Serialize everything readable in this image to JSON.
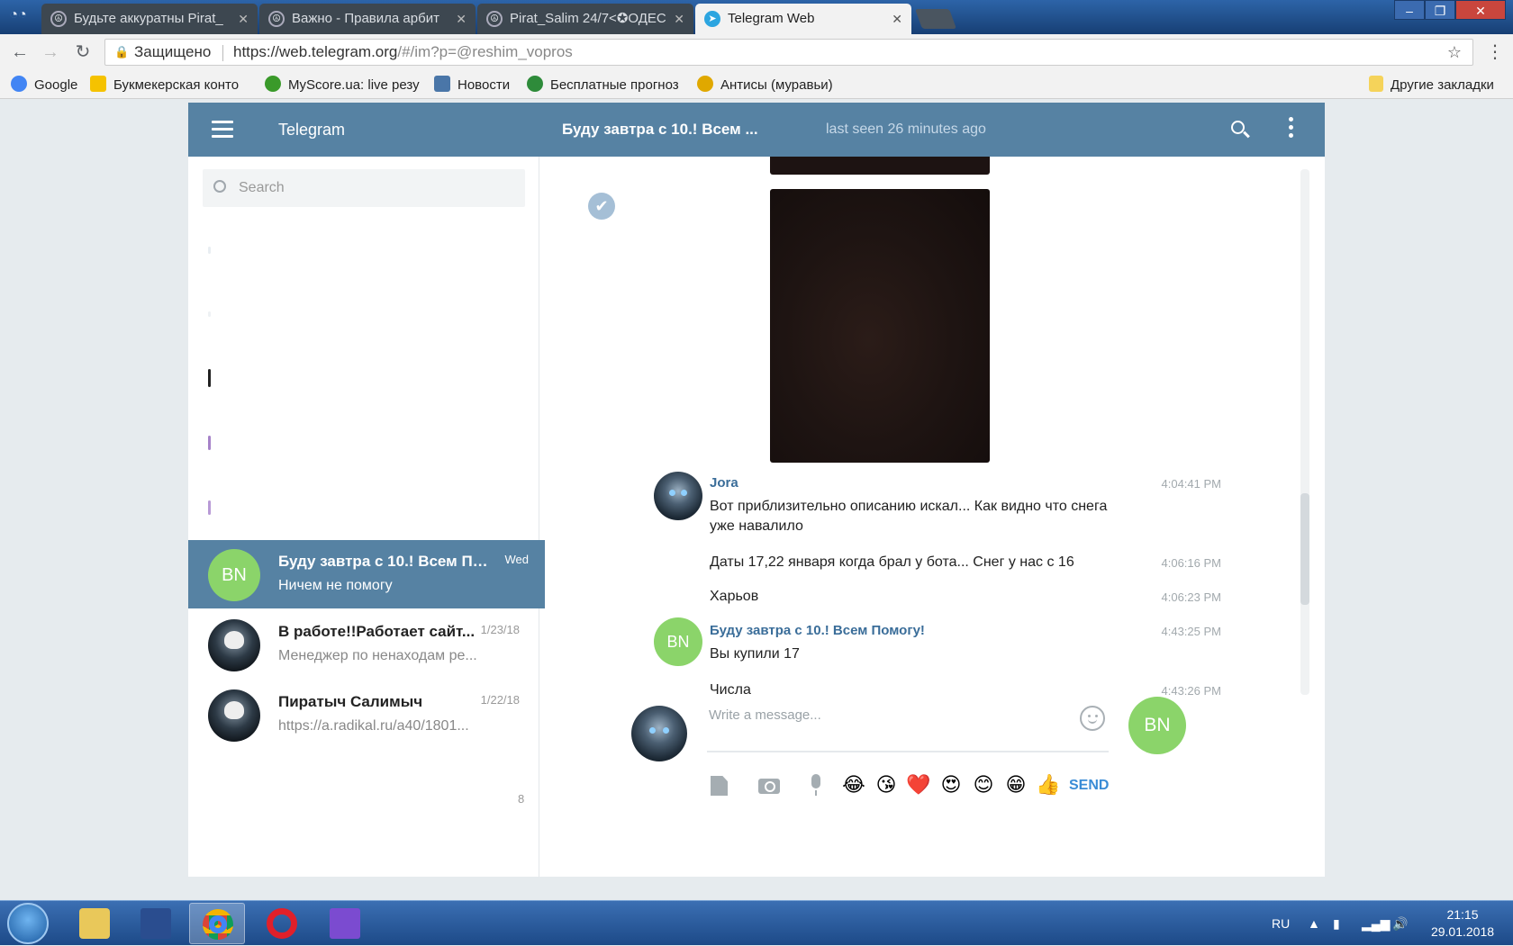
{
  "browser": {
    "tabs": [
      {
        "title": "Будьте аккуратны Pirat_",
        "active": false
      },
      {
        "title": "Важно - Правила арбит",
        "active": false
      },
      {
        "title": "Pirat_Salim 24/7<✪ОДЕС",
        "active": false
      },
      {
        "title": "Telegram Web",
        "active": true
      }
    ],
    "security_label": "Защищено",
    "url_host": "https://web.telegram.org",
    "url_path": "/#/im?p=@reshim_vopros",
    "bookmarks": [
      {
        "label": "Google",
        "color": "#4285f4"
      },
      {
        "label": "Букмекерская конто",
        "color": "#f5c200"
      },
      {
        "label": "MyScore.ua: live резу",
        "color": "#3a9a2a"
      },
      {
        "label": "Новости",
        "color": "#4a76a8"
      },
      {
        "label": "Бесплатные прогноз",
        "color": "#2e8b3a"
      },
      {
        "label": "Антисы (муравьи)",
        "color": "#e0a800"
      }
    ],
    "other_bookmarks": "Другие закладки"
  },
  "telegram": {
    "app_title": "Telegram",
    "peer_name": "Буду завтра с 10.! Всем ...",
    "peer_status": "last seen 26 minutes ago",
    "search_placeholder": "Search",
    "dialogs": [
      {
        "avatar_initials": "BN",
        "name": "Буду завтра с 10.! Всем По...",
        "preview": "Ничем не помогу",
        "date": "Wed",
        "active": true
      },
      {
        "avatar_initials": "",
        "name": "В работе!!Работает сайт...",
        "preview": "Менеджер по ненаходам ре...",
        "date": "1/23/18",
        "active": false
      },
      {
        "avatar_initials": "",
        "name": "Пиратыч Салимыч",
        "preview": "https://a.radikal.ru/a40/1801...",
        "date": "1/22/18",
        "active": false
      }
    ],
    "stray_counter": "8",
    "messages": [
      {
        "sender": "Jora",
        "text": "Вот приблизительно описанию искал... Как видно что снега уже навалило",
        "time": "4:04:41 PM"
      },
      {
        "sender": "",
        "text": "Даты 17,22 января когда брал у бота... Снег у нас с 16",
        "time": "4:06:16 PM"
      },
      {
        "sender": "",
        "text": "Харьов",
        "time": "4:06:23 PM"
      },
      {
        "sender": "Буду завтра с 10.! Всем Помогу!",
        "avatar_initials": "BN",
        "text": "Вы купили 17",
        "time": "4:43:25 PM"
      },
      {
        "sender": "",
        "text": "Числа",
        "time": "4:43:26 PM"
      }
    ],
    "composer": {
      "placeholder": "Write a message...",
      "send_avatar_initials": "BN",
      "send_label": "SEND",
      "quick_emojis": [
        "😂",
        "😘",
        "❤️",
        "😍",
        "😊",
        "😁",
        "👍"
      ]
    },
    "colors": {
      "header": "#5682a3",
      "avatar_green": "#8bd46a",
      "sender_blue": "#3a6d99",
      "send_blue": "#3a8cd6"
    }
  },
  "taskbar": {
    "language": "RU",
    "time": "21:15",
    "date": "29.01.2018"
  }
}
